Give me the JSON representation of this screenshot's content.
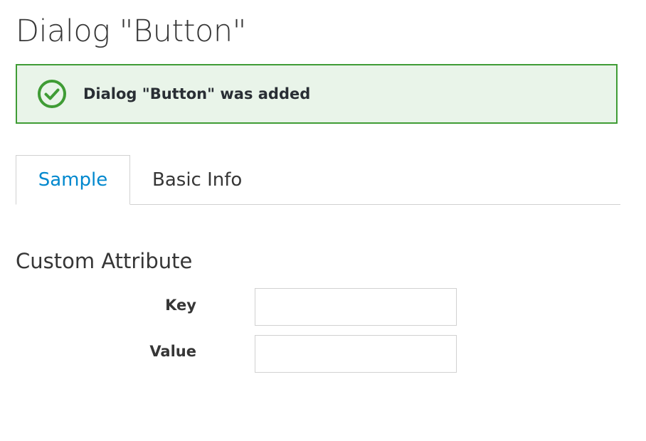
{
  "page": {
    "title": "Dialog \"Button\""
  },
  "alert": {
    "icon": "check-circle-icon",
    "message": "Dialog \"Button\" was added",
    "colors": {
      "border": "#3f9c35",
      "background": "#e9f4e9",
      "icon": "#3f9c35"
    }
  },
  "tabs": [
    {
      "label": "Sample",
      "active": true
    },
    {
      "label": "Basic Info",
      "active": false
    }
  ],
  "section": {
    "title": "Custom Attribute"
  },
  "form": {
    "key": {
      "label": "Key",
      "value": "",
      "placeholder": ""
    },
    "value": {
      "label": "Value",
      "value": "",
      "placeholder": ""
    }
  },
  "colors": {
    "accent": "#0088ce",
    "text": "#363636",
    "border": "#d1d1d1"
  }
}
